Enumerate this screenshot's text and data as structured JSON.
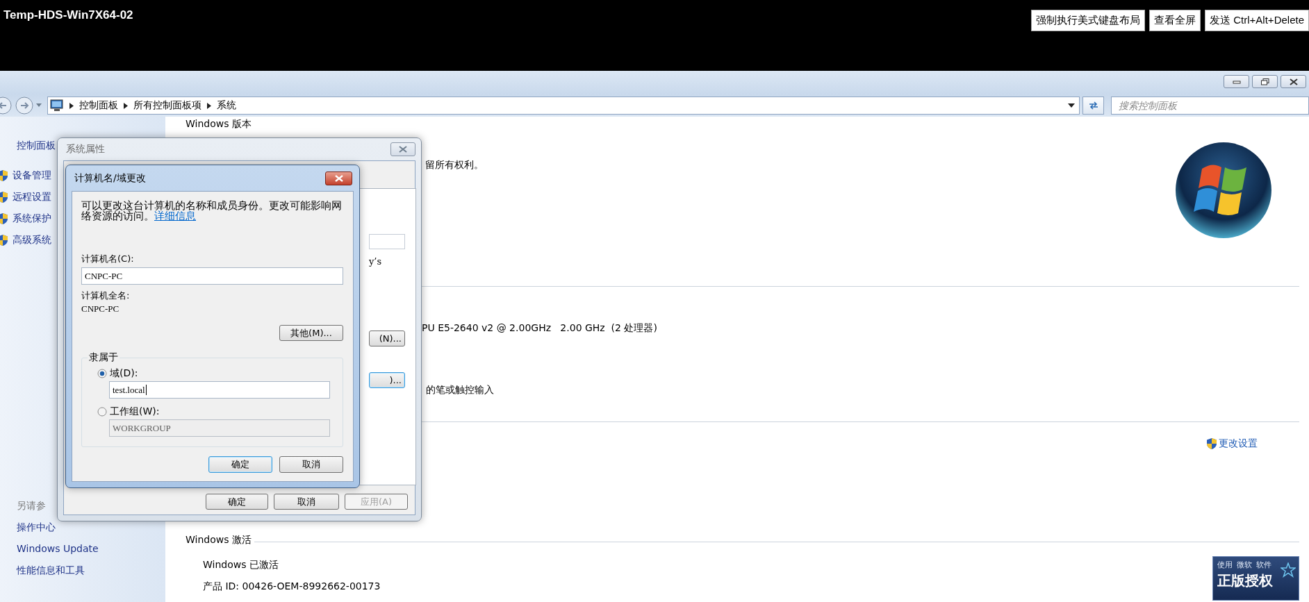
{
  "session": {
    "title": "Temp-HDS-Win7X64-02",
    "buttons": [
      "强制执行美式键盘布局",
      "查看全屏",
      "发送 Ctrl+Alt+Delete"
    ]
  },
  "address_bar": {
    "breadcrumb": [
      "控制面板",
      "所有控制面板项",
      "系统"
    ],
    "search": {
      "placeholder": "搜索控制面板"
    }
  },
  "sidebar": {
    "home": "控制面板",
    "tasks": [
      "设备管理",
      "远程设置",
      "系统保护",
      "高级系统"
    ],
    "see_also": {
      "heading": "另请参",
      "links": [
        "操作中心",
        "Windows Update",
        "性能信息和工具"
      ]
    }
  },
  "content": {
    "edition_heading": "Windows 版本",
    "copyright": "留所有权利。",
    "processor": "PU E5-2640 v2 @ 2.00GHz   2.00 GHz  (2 处理器)",
    "pen": "的笔或触控输入",
    "change_settings": "更改设置",
    "activation": {
      "heading": "Windows 激活",
      "status": "Windows 已激活",
      "product_id": "产品 ID: 00426-OEM-8992662-00173"
    },
    "genuine_badge": {
      "caption": [
        "使用",
        "微软",
        "软件"
      ],
      "title": "正版授权"
    }
  },
  "system_properties": {
    "title": "系统属性",
    "panel_items": [
      {
        "kind": "text",
        "text": "y’s"
      },
      {
        "kind": "button",
        "text": "(N)...",
        "focused": false
      },
      {
        "kind": "button",
        "text": ")...",
        "focused": true
      }
    ],
    "buttons": [
      {
        "label": "确定",
        "disabled": false
      },
      {
        "label": "取消",
        "disabled": false
      },
      {
        "label": "应用(A)",
        "disabled": true
      }
    ]
  },
  "rename_dialog": {
    "title": "计算机名/域更改",
    "description": "可以更改这台计算机的名称和成员身份。更改可能影响网络资源的访问。",
    "details_link": "详细信息",
    "computer_name": {
      "label": "计算机名(C):",
      "value": "CNPC-PC"
    },
    "full_name": {
      "label": "计算机全名:",
      "value": "CNPC-PC"
    },
    "more_button": "其他(M)...",
    "membership": {
      "legend": "隶属于",
      "options": [
        {
          "label": "域(D):",
          "selected": true,
          "value": "test.local",
          "disabled": false
        },
        {
          "label": "工作组(W):",
          "selected": false,
          "value": "WORKGROUP",
          "disabled": true
        }
      ]
    },
    "buttons": [
      {
        "label": "确定",
        "default": true
      },
      {
        "label": "取消",
        "default": false
      }
    ]
  }
}
